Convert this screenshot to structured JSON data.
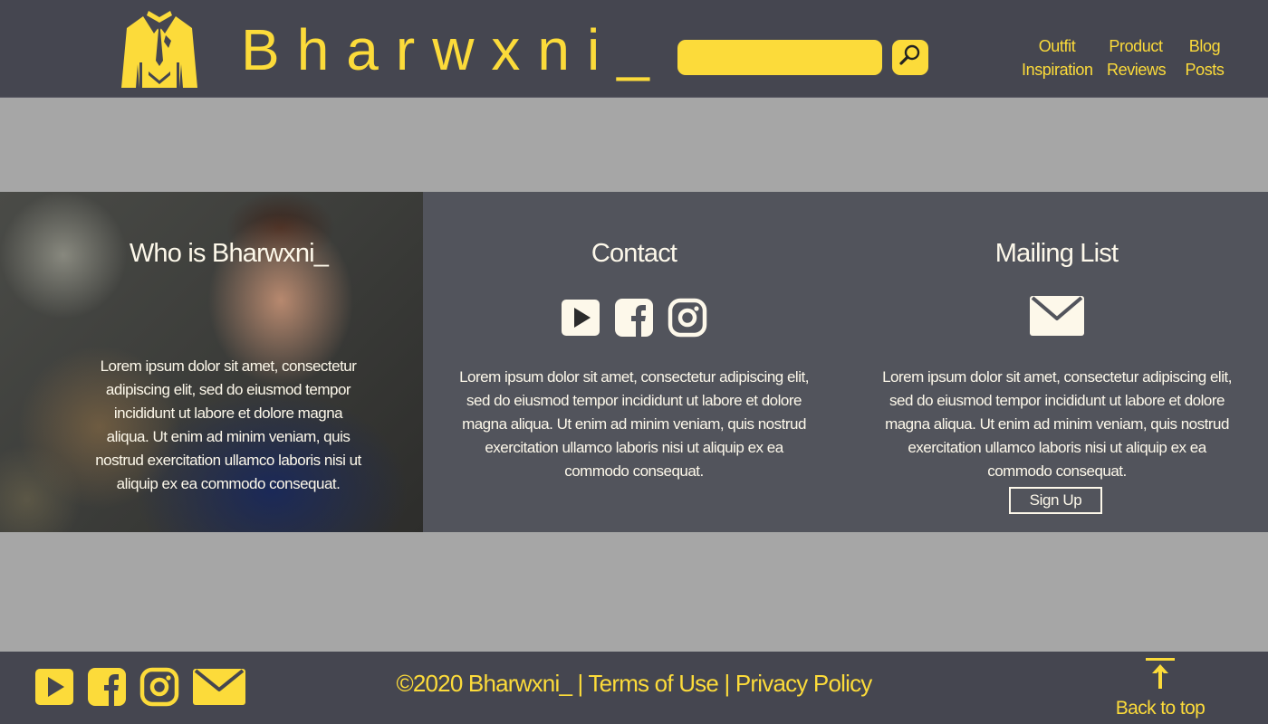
{
  "colors": {
    "accent": "#fcdb3a",
    "header_bg": "#454650",
    "page_bg": "#a6a6a6",
    "band_bg": "#52545c",
    "text_light": "#fdf8ea"
  },
  "header": {
    "logo_icon": "suit-jacket-icon",
    "brand": "Bharwxni_",
    "search": {
      "placeholder": "",
      "value": "",
      "button_icon": "search-icon"
    },
    "nav": [
      {
        "line1": "Outfit",
        "line2": "Inspiration"
      },
      {
        "line1": "Product",
        "line2": "Reviews"
      },
      {
        "line1": "Blog",
        "line2": "Posts"
      }
    ]
  },
  "about": {
    "title": "Who is Bharwxni_",
    "text": "Lorem ipsum dolor sit amet, consectetur adipiscing elit, sed do eiusmod tempor incididunt ut labore et dolore magna aliqua. Ut enim ad minim veniam, quis nostrud exercitation ullamco laboris nisi ut aliquip ex ea commodo consequat."
  },
  "contact": {
    "title": "Contact",
    "icons": [
      "youtube-icon",
      "facebook-icon",
      "instagram-icon"
    ],
    "text": "Lorem ipsum dolor sit amet, consectetur adipiscing elit, sed do eiusmod tempor incididunt ut labore et dolore magna aliqua. Ut enim ad minim veniam, quis nostrud exercitation ullamco laboris nisi ut aliquip ex ea commodo consequat."
  },
  "mailing": {
    "title": "Mailing List",
    "icon": "envelope-icon",
    "text": "Lorem ipsum dolor sit amet, consectetur adipiscing elit, sed do eiusmod tempor incididunt ut labore et dolore magna aliqua. Ut enim ad minim veniam, quis nostrud exercitation ullamco laboris nisi ut aliquip ex ea commodo consequat.",
    "signup_label": "Sign Up"
  },
  "footer": {
    "icons": [
      "youtube-icon",
      "facebook-icon",
      "instagram-icon",
      "envelope-icon"
    ],
    "copyright": "©2020 Bharwxni_",
    "separator": "|",
    "terms": "Terms of Use",
    "privacy": "Privacy Policy",
    "back_to_top": "Back to top",
    "back_to_top_icon": "arrow-up-bar-icon"
  }
}
